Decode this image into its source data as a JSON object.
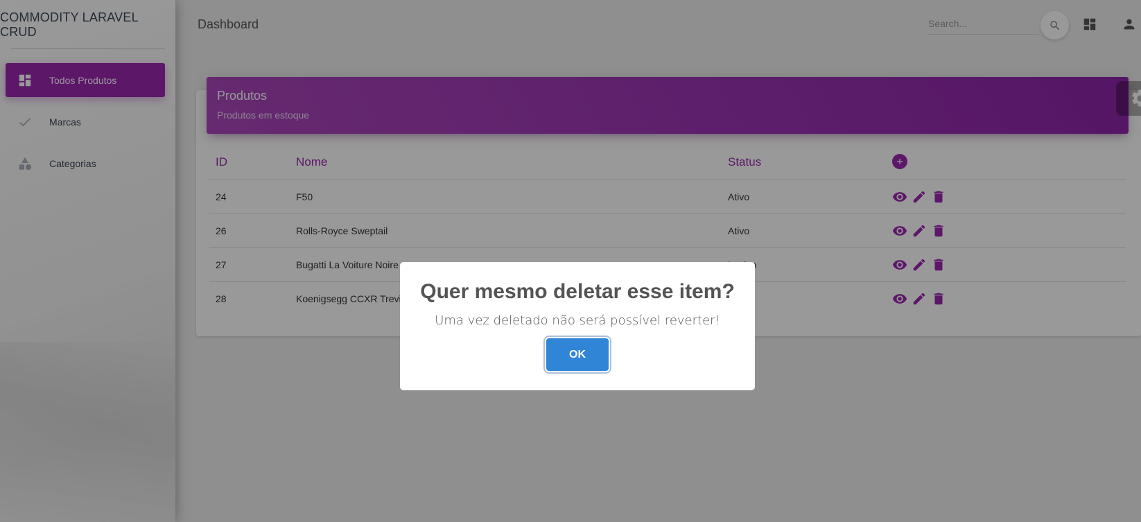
{
  "app": {
    "title": "COMMODITY LARAVEL CRUD"
  },
  "sidebar": {
    "items": [
      {
        "label": "Todos Produtos",
        "icon": "dashboard-icon",
        "active": true
      },
      {
        "label": "Marcas",
        "icon": "check-icon",
        "active": false
      },
      {
        "label": "Categorias",
        "icon": "category-icon",
        "active": false
      }
    ]
  },
  "topbar": {
    "title": "Dashboard",
    "search": {
      "placeholder": "Search...",
      "value": ""
    }
  },
  "card": {
    "title": "Produtos",
    "subtitle": "Produtos em estoque",
    "columns": [
      "ID",
      "Nome",
      "Status"
    ],
    "rows": [
      {
        "id": "24",
        "nome": "F50",
        "status": "Ativo"
      },
      {
        "id": "26",
        "nome": "Rolls-Royce Sweptail",
        "status": "Ativo"
      },
      {
        "id": "27",
        "nome": "Bugatti La Voiture Noire",
        "status": "Inativo"
      },
      {
        "id": "28",
        "nome": "Koenigsegg CCXR Trevita",
        "status": ""
      }
    ]
  },
  "modal": {
    "title": "Quer mesmo deletar esse item?",
    "text": "Uma vez deletado não será possível reverter!",
    "confirm_label": "OK"
  },
  "colors": {
    "accent": "#9c27b0",
    "confirm": "#3085d6"
  }
}
